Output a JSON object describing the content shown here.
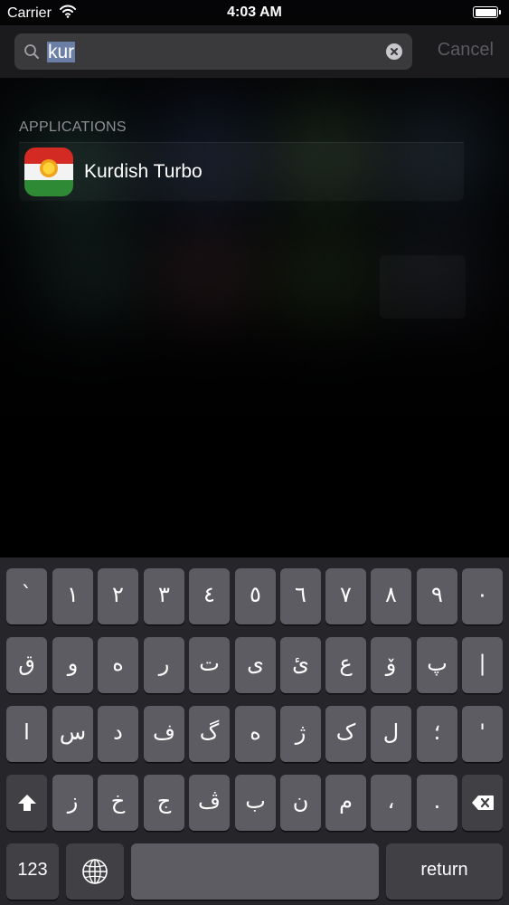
{
  "status_bar": {
    "carrier": "Carrier",
    "time": "4:03 AM"
  },
  "search": {
    "query": "kur",
    "cancel_label": "Cancel"
  },
  "results": {
    "section_header": "APPLICATIONS",
    "items": [
      {
        "name": "Kurdish Turbo"
      }
    ]
  },
  "keyboard": {
    "row1": [
      "`",
      "١",
      "٢",
      "٣",
      "٤",
      "٥",
      "٦",
      "٧",
      "٨",
      "٩",
      "٠"
    ],
    "row2": [
      "ق",
      "و",
      "ە",
      "ر",
      "ت",
      "ی",
      "ئ",
      "ع",
      "ۆ",
      "پ",
      "|"
    ],
    "row3": [
      "ا",
      "س",
      "د",
      "ف",
      "گ",
      "ه",
      "ژ",
      "ک",
      "ل",
      "؛",
      "'"
    ],
    "row4": [
      "ز",
      "خ",
      "ج",
      "ڤ",
      "ب",
      "ن",
      "م",
      "،",
      "."
    ],
    "numbers_label": "123",
    "return_label": "return"
  },
  "colors": {
    "keyboard_bg": "#26262a",
    "key_bg": "#5c5c62",
    "key_dark_bg": "#404045",
    "section_header": "#8e8e93",
    "cancel_text": "#5a5a60"
  },
  "icons": {
    "wifi": "wifi-icon",
    "battery": "battery-icon",
    "search": "search-icon",
    "clear": "clear-icon",
    "shift": "shift-icon",
    "delete": "delete-icon",
    "globe": "globe-icon"
  }
}
